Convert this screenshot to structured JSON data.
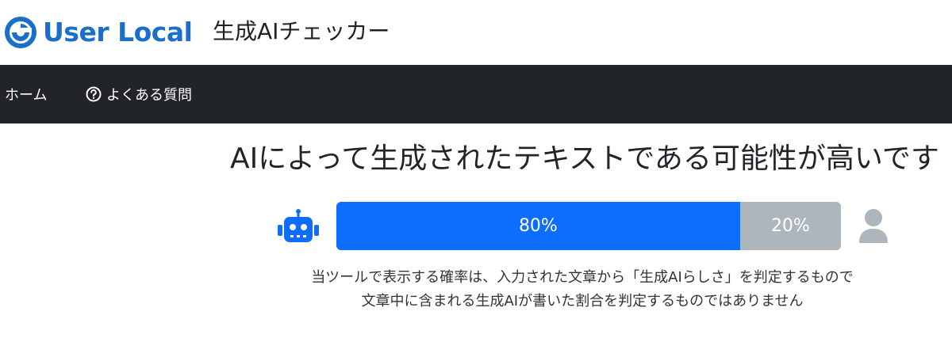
{
  "header": {
    "logo_text": "User Local",
    "app_name": "生成AIチェッカー",
    "brand_color": "#1a6fc9"
  },
  "nav": {
    "home_label": "ホーム",
    "faq_label": "よくある質問",
    "faq_icon": "question-circle-icon",
    "background": "#212529"
  },
  "result": {
    "title": "AIによって生成されたテキストである可能性が高いです",
    "ai_percent_label": "80%",
    "human_percent_label": "20%",
    "ai_fraction": 0.8,
    "human_fraction": 0.2,
    "ai_icon": "robot-icon",
    "human_icon": "person-icon",
    "ai_color": "#0d6efd",
    "human_color": "#adb5bd"
  },
  "notice": {
    "line1": "当ツールで表示する確率は、入力された文章から「生成AIらしさ」を判定するもので",
    "line2": "文章中に含まれる生成AIが書いた割合を判定するものではありません"
  }
}
